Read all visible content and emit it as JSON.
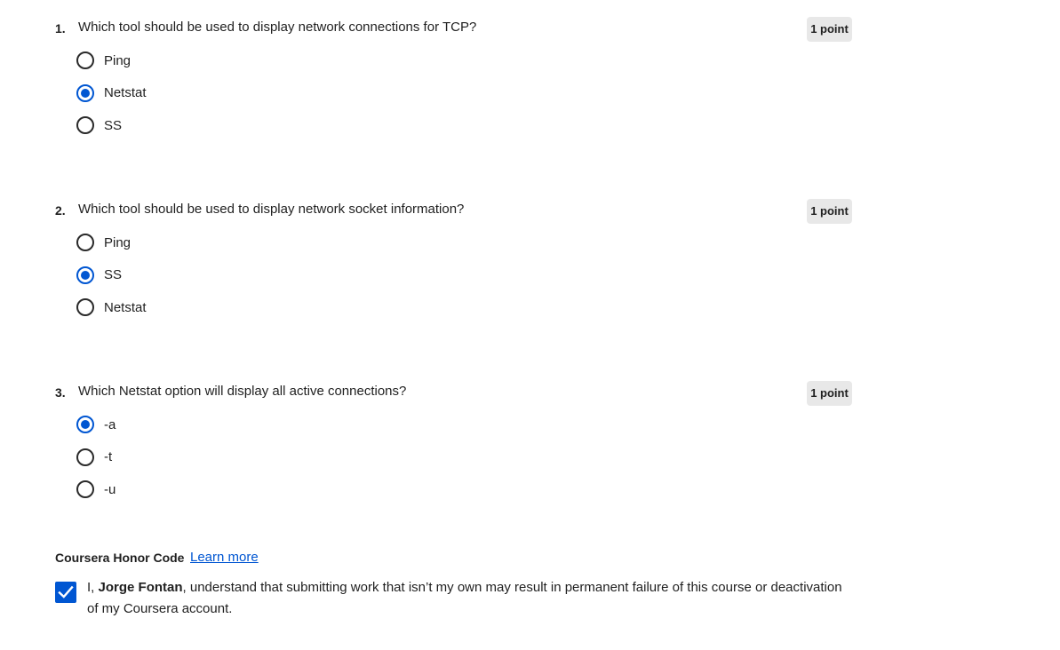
{
  "questions": [
    {
      "number": "1.",
      "text": "Which tool should be used to display network connections for TCP?",
      "points": "1 point",
      "options": [
        {
          "label": "Ping",
          "selected": false
        },
        {
          "label": "Netstat",
          "selected": true
        },
        {
          "label": "SS",
          "selected": false
        }
      ]
    },
    {
      "number": "2.",
      "text": "Which tool should be used to display network socket information?",
      "points": "1 point",
      "options": [
        {
          "label": "Ping",
          "selected": false
        },
        {
          "label": "SS",
          "selected": true
        },
        {
          "label": "Netstat",
          "selected": false
        }
      ]
    },
    {
      "number": "3.",
      "text": "Which Netstat option will display all active connections?",
      "points": "1 point",
      "options": [
        {
          "label": "-a",
          "selected": true
        },
        {
          "label": "-t",
          "selected": false
        },
        {
          "label": "-u",
          "selected": false
        }
      ]
    }
  ],
  "honor_code": {
    "title": "Coursera Honor Code",
    "learn_more": "Learn more",
    "checked": true,
    "text_prefix": "I, ",
    "name": "Jorge Fontan",
    "text_suffix": ", understand that submitting work that isn’t my own may result in permanent failure of this course or deactivation of my Coursera account."
  },
  "colors": {
    "accent": "#0056d2",
    "points_badge_bg": "#e8e8e8"
  },
  "icons": {
    "radio_checked": "radio-checked-icon",
    "radio_unchecked": "radio-unchecked-icon",
    "checkbox_checked": "checkmark-icon"
  }
}
